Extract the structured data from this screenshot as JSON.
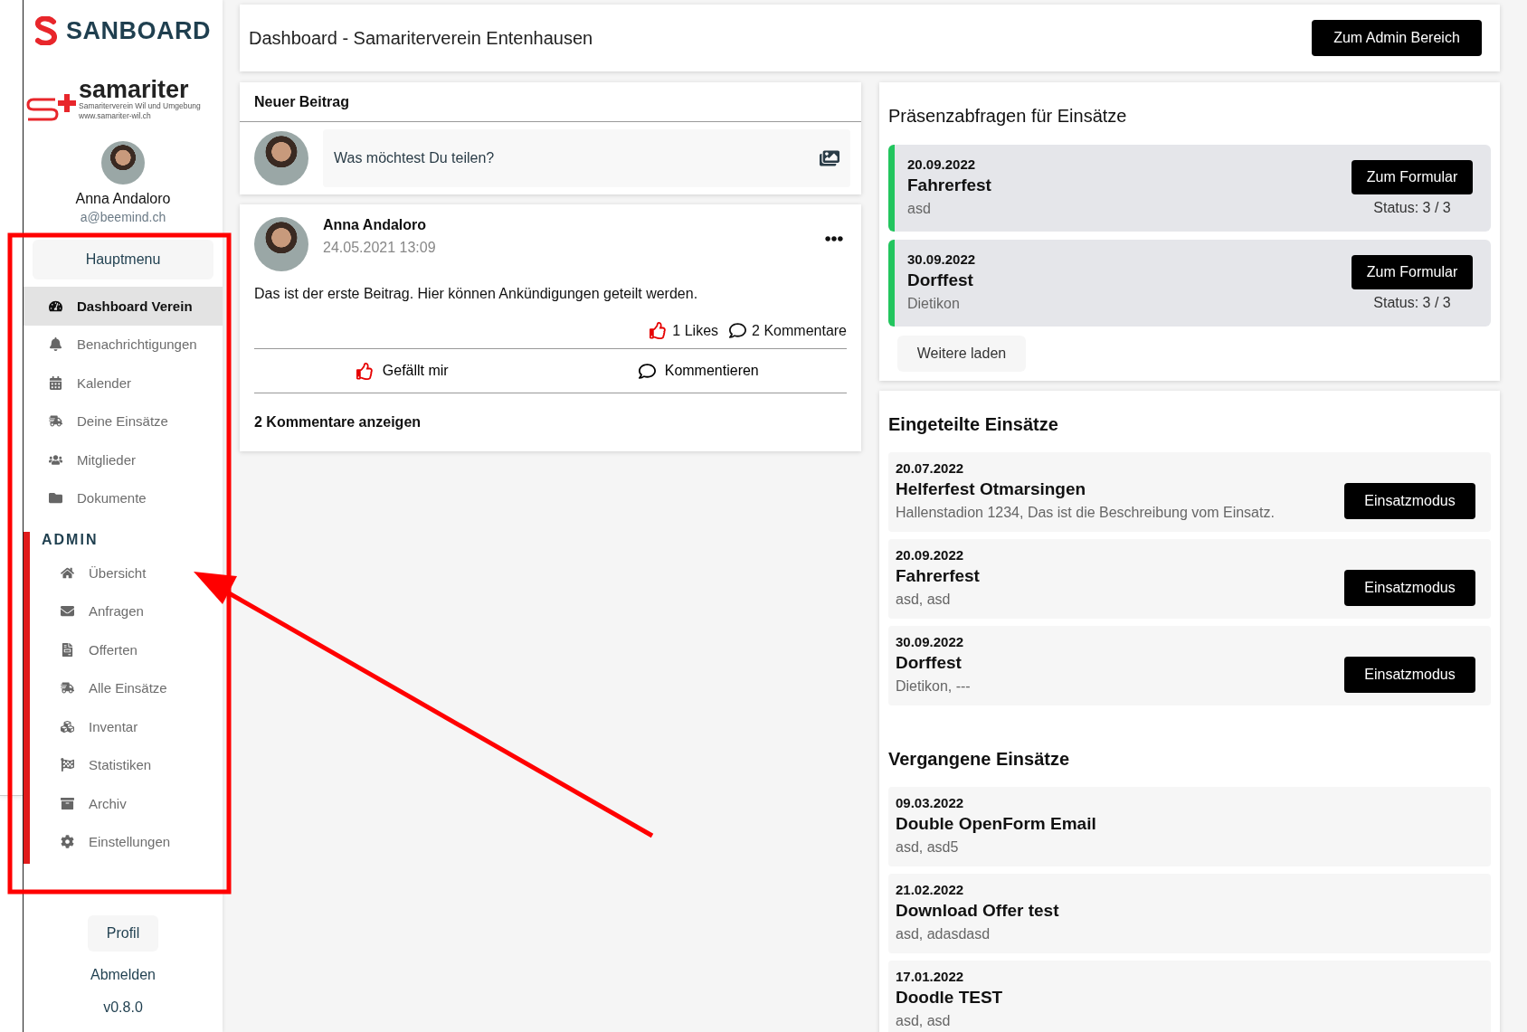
{
  "sidebar": {
    "brand": "SANBOARD",
    "org_logo": {
      "name": "samariter",
      "subtitle": "Samariterverein Wil und Umgebung",
      "url": "www.samariter-wil.ch"
    },
    "user": {
      "name": "Anna Andaloro",
      "email": "a@beemind.ch"
    },
    "main_menu_label": "Hauptmenu",
    "main_items": [
      {
        "label": "Dashboard Verein",
        "selected": true
      },
      {
        "label": "Benachrichtigungen",
        "selected": false
      },
      {
        "label": "Kalender",
        "selected": false
      },
      {
        "label": "Deine Einsätze",
        "selected": false
      },
      {
        "label": "Mitglieder",
        "selected": false
      },
      {
        "label": "Dokumente",
        "selected": false
      }
    ],
    "admin_label": "ADMIN",
    "admin_items": [
      {
        "label": "Übersicht",
        "selected": false
      },
      {
        "label": "Anfragen",
        "selected": false
      },
      {
        "label": "Offerten",
        "selected": false
      },
      {
        "label": "Alle Einsätze",
        "selected": false
      },
      {
        "label": "Inventar",
        "selected": false
      },
      {
        "label": "Statistiken",
        "selected": false
      },
      {
        "label": "Archiv",
        "selected": false
      },
      {
        "label": "Einstellungen",
        "selected": false
      }
    ],
    "profile_button": "Profil",
    "logout": "Abmelden",
    "version": "v0.8.0"
  },
  "header": {
    "title": "Dashboard - Samariterverein Entenhausen",
    "button": "Zum Admin Bereich"
  },
  "new_post": {
    "title": "Neuer Beitrag",
    "placeholder": "Was möchtest Du teilen?"
  },
  "post": {
    "author": "Anna Andaloro",
    "date": "24.05.2021 13:09",
    "text": "Das ist der erste Beitrag. Hier können Ankündigungen geteilt werden.",
    "likes": "1 Likes",
    "comments": "2 Kommentare",
    "like_button": "Gefällt mir",
    "comment_button": "Kommentieren",
    "show_comments": "2 Kommentare anzeigen"
  },
  "attendance": {
    "title": "Präsenzabfragen für Einsätze",
    "items": [
      {
        "date": "20.09.2022",
        "name": "Fahrerfest",
        "place": "asd",
        "button": "Zum Formular",
        "status": "Status: 3 / 3"
      },
      {
        "date": "30.09.2022",
        "name": "Dorffest",
        "place": "Dietikon",
        "button": "Zum Formular",
        "status": "Status: 3 / 3"
      }
    ],
    "load_more": "Weitere laden"
  },
  "assigned": {
    "title": "Eingeteilte Einsätze",
    "items": [
      {
        "date": "20.07.2022",
        "name": "Helferfest Otmarsingen",
        "place": "Hallenstadion 1234, Das ist die Beschreibung vom Einsatz.",
        "button": "Einsatzmodus"
      },
      {
        "date": "20.09.2022",
        "name": "Fahrerfest",
        "place": "asd, asd",
        "button": "Einsatzmodus"
      },
      {
        "date": "30.09.2022",
        "name": "Dorffest",
        "place": "Dietikon, ---",
        "button": "Einsatzmodus"
      }
    ]
  },
  "past": {
    "title": "Vergangene Einsätze",
    "items": [
      {
        "date": "09.03.2022",
        "name": "Double OpenForm Email",
        "place": "asd, asd5"
      },
      {
        "date": "21.02.2022",
        "name": "Download Offer test",
        "place": "asd, adasdasd"
      },
      {
        "date": "17.01.2022",
        "name": "Doodle TEST",
        "place": "asd, asd"
      }
    ]
  }
}
